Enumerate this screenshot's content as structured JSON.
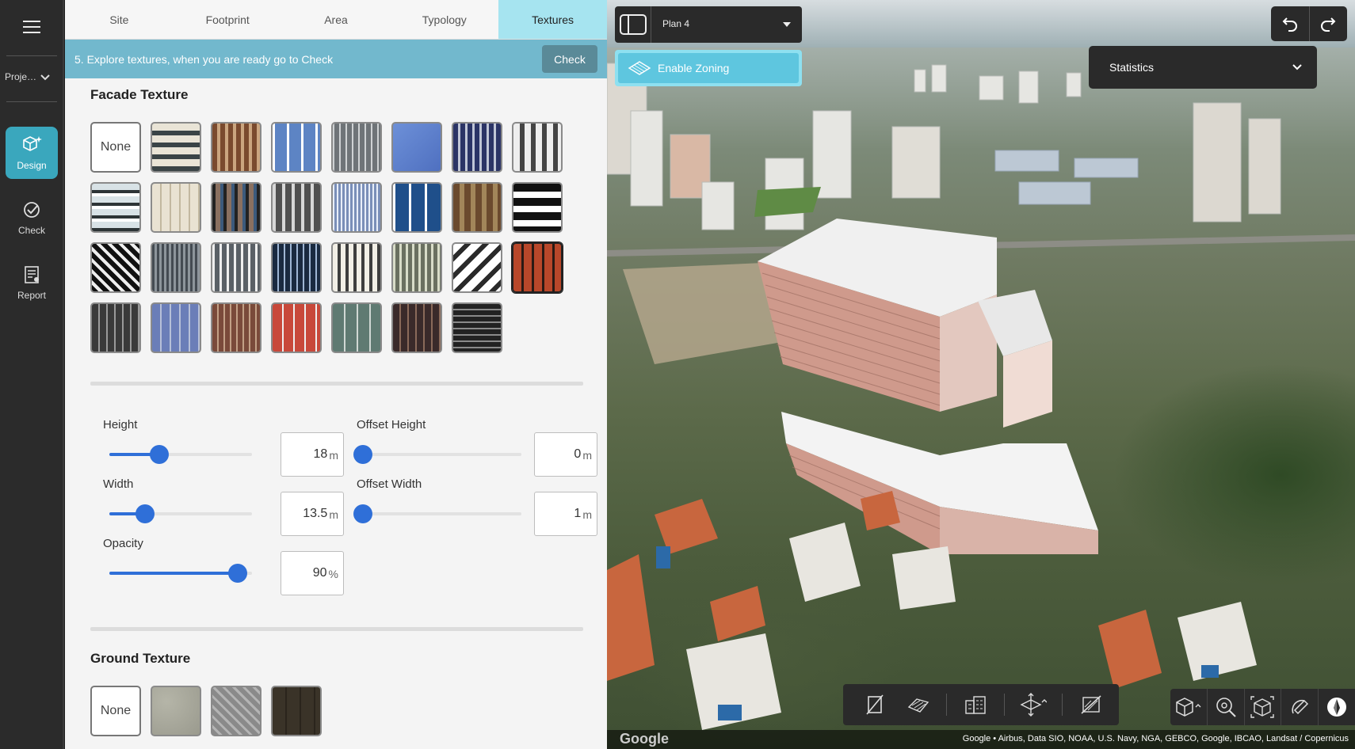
{
  "rail": {
    "project_label": "Proje…",
    "items": [
      {
        "label": "Design",
        "icon": "cube-sparkle-icon",
        "active": true
      },
      {
        "label": "Check",
        "icon": "check-circle-icon",
        "active": false
      },
      {
        "label": "Report",
        "icon": "report-icon",
        "active": false
      }
    ]
  },
  "tabs": [
    {
      "label": "Site",
      "active": false
    },
    {
      "label": "Footprint",
      "active": false
    },
    {
      "label": "Area",
      "active": false
    },
    {
      "label": "Typology",
      "active": false
    },
    {
      "label": "Textures",
      "active": true
    }
  ],
  "info": {
    "message": "5. Explore textures, when you are ready go to Check",
    "button": "Check"
  },
  "facade": {
    "title": "Facade Texture",
    "none_label": "None",
    "selected_index": 23
  },
  "sliders": {
    "height": {
      "label": "Height",
      "value": "18",
      "unit": "m",
      "level": 0.35
    },
    "offset_height": {
      "label": "Offset Height",
      "value": "0",
      "unit": "m",
      "level": 0.0
    },
    "width": {
      "label": "Width",
      "value": "13.5",
      "unit": "m",
      "level": 0.25
    },
    "offset_width": {
      "label": "Offset Width",
      "value": "1",
      "unit": "m",
      "level": 0.0
    },
    "opacity": {
      "label": "Opacity",
      "value": "90",
      "unit": "%",
      "level": 0.9
    }
  },
  "ground": {
    "title": "Ground Texture",
    "none_label": "None"
  },
  "map": {
    "plan_name": "Plan 4",
    "zoning_label": "Enable Zoning",
    "statistics_label": "Statistics",
    "logo": "Google",
    "attribution": "Google • Airbus, Data SIO, NOAA, U.S. Navy, NGA, GEBCO, Google, IBCAO, Landsat / Copernicus"
  },
  "colors": {
    "accent": "#3aa7bd",
    "tab_active": "#a6e4f0",
    "info_bar": "#72b8cd",
    "slider": "#2f6fd8"
  }
}
